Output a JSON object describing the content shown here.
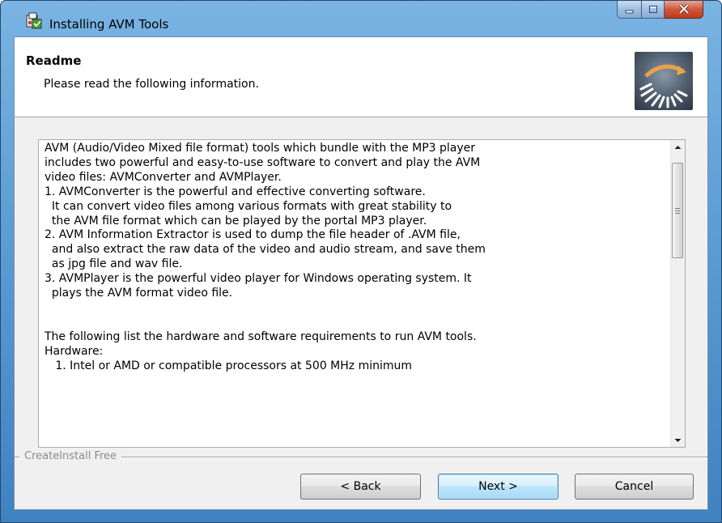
{
  "window": {
    "title": "Installing AVM Tools",
    "icons": {
      "app": "installer-icon",
      "minimize": "minimize-icon",
      "maximize": "maximize-icon",
      "close": "close-icon"
    }
  },
  "header": {
    "title": "Readme",
    "subtitle": "Please read the following information.",
    "logo_icon": "installer-logo-icon"
  },
  "readme": {
    "text": "AVM (Audio/Video Mixed file format) tools which bundle with the MP3 player\nincludes two powerful and easy-to-use software to convert and play the AVM\nvideo files: AVMConverter and AVMPlayer.\n1. AVMConverter is the powerful and effective converting software.\n  It can convert video files among various formats with great stability to\n  the AVM file format which can be played by the portal MP3 player.\n2. AVM Information Extractor is used to dump the file header of .AVM file,\n  and also extract the raw data of the video and audio stream, and save them\n  as jpg file and wav file.\n3. AVMPlayer is the powerful video player for Windows operating system. It\n  plays the AVM format video file.\n\n\nThe following list the hardware and software requirements to run AVM tools.\nHardware:\n   1. Intel or AMD or compatible processors at 500 MHz minimum"
  },
  "branding": {
    "text": "CreateInstall Free"
  },
  "buttons": {
    "back": "< Back",
    "next": "Next >",
    "cancel": "Cancel"
  },
  "colors": {
    "window_frame": "#5e9fd6",
    "dialog_bg": "#f0f0f0",
    "close_button": "#c0391c",
    "default_button_border": "#3c7fb1"
  }
}
